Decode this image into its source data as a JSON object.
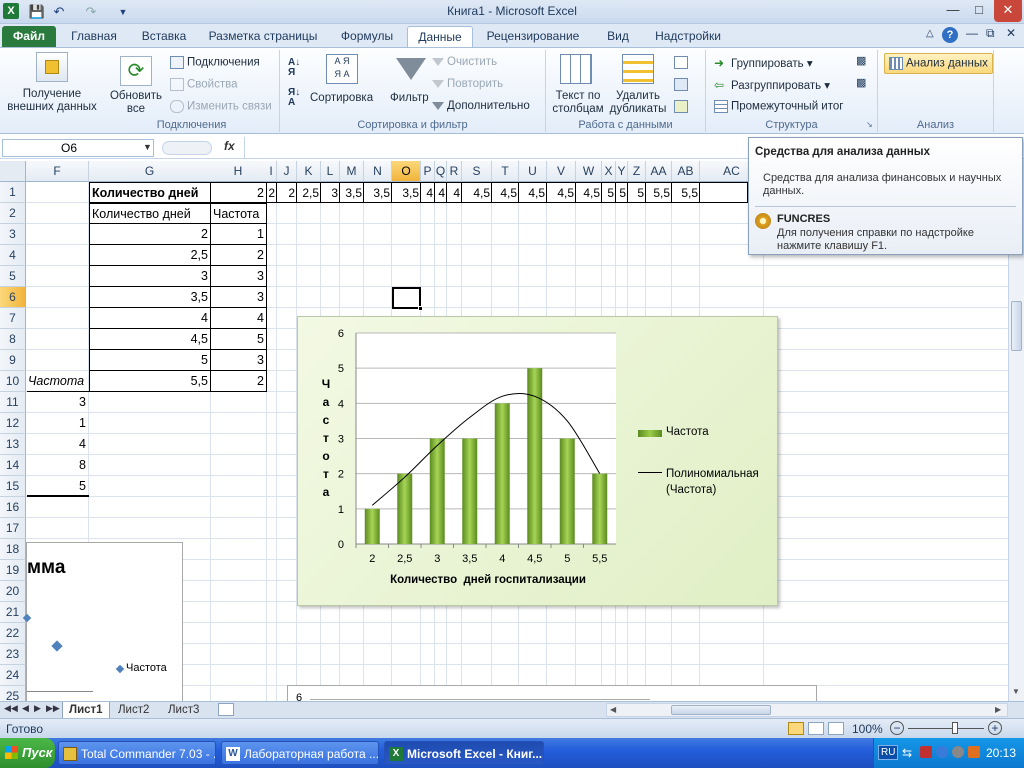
{
  "app": {
    "title": "Книга1  -  Microsoft Excel"
  },
  "tabs": [
    "Файл",
    "Главная",
    "Вставка",
    "Разметка страницы",
    "Формулы",
    "Данные",
    "Рецензирование",
    "Вид",
    "Надстройки"
  ],
  "ribbon": {
    "get_external": "Получение внешних данных",
    "refresh_all": "Обновить все",
    "connections": "Подключения",
    "properties": "Свойства",
    "edit_links": "Изменить связи",
    "group_connections": "Подключения",
    "sort": "Сортировка",
    "filter": "Фильтр",
    "clear": "Очистить",
    "reapply": "Повторить",
    "advanced": "Дополнительно",
    "group_sort": "Сортировка и фильтр",
    "text_to_columns": "Текст по столбцам",
    "remove_duplicates": "Удалить дубликаты",
    "group_data_tools": "Работа с данными",
    "group_btn": "Группировать",
    "ungroup_btn": "Разгруппировать",
    "subtotal": "Промежуточный итог",
    "group_outline": "Структура",
    "data_analysis": "Анализ данных",
    "group_analysis": "Анализ"
  },
  "formula_bar": {
    "name_box": "O6",
    "fx": "fx"
  },
  "grid": {
    "columns": [
      "F",
      "G",
      "H",
      "I",
      "J",
      "K",
      "L",
      "M",
      "N",
      "O",
      "P",
      "Q",
      "R",
      "S",
      "T",
      "U",
      "V",
      "W",
      "X",
      "Y",
      "Z",
      "AA",
      "AB",
      "AC"
    ],
    "rows": [
      "1",
      "2",
      "3",
      "4",
      "5",
      "6",
      "7",
      "8",
      "9",
      "10",
      "11",
      "12",
      "13",
      "14",
      "15",
      "16",
      "17",
      "18",
      "19",
      "20",
      "21",
      "22",
      "23",
      "24",
      "25"
    ],
    "g1": "Количество дней",
    "h1": "2",
    "row1_values": [
      "2",
      "2",
      "2,5",
      "3",
      "3,5",
      "3,5",
      "3,5",
      "4",
      "4",
      "4",
      "4,5",
      "4,5",
      "4,5",
      "4,5",
      "4,5",
      "5",
      "5",
      "5",
      "5,5",
      "5,5"
    ],
    "g2": "Количество дней",
    "h2": "Частота",
    "table_days": [
      "2",
      "2,5",
      "3",
      "3,5",
      "4",
      "4,5",
      "5",
      "5,5"
    ],
    "table_freq": [
      "1",
      "2",
      "3",
      "3",
      "4",
      "5",
      "3",
      "2"
    ],
    "f10": "Частота",
    "f_values": [
      "3",
      "1",
      "4",
      "8",
      "5"
    ]
  },
  "tooltip": {
    "title": "Средства для анализа данных",
    "desc": "Средства для анализа финансовых и научных данных.",
    "addin": "FUNCRES",
    "help": "Для получения справки по надстройке нажмите клавишу F1."
  },
  "chart_data": {
    "type": "bar",
    "categories": [
      "2",
      "2,5",
      "3",
      "3,5",
      "4",
      "4,5",
      "5",
      "5,5"
    ],
    "series": [
      {
        "name": "Частота",
        "values": [
          1,
          2,
          3,
          3,
          4,
          5,
          3,
          2
        ]
      }
    ],
    "trendline": {
      "name": "Полиномиальная (Частота)",
      "values": [
        1.1,
        1.9,
        2.8,
        3.6,
        4.2,
        4.2,
        3.5,
        2
      ]
    },
    "xlabel": "Количество  дней госпитализации",
    "ylabel": "Частота",
    "y_ticks": [
      "0",
      "1",
      "2",
      "3",
      "4",
      "5",
      "6"
    ],
    "ylim": [
      0,
      6
    ],
    "legend_position": "right",
    "colors": {
      "bar": "#8ab83a",
      "bar_dark": "#5a8a1e",
      "line": "#000000"
    }
  },
  "chart2": {
    "title_fragment": "мма",
    "legend": "Частота"
  },
  "chart3": {
    "tick": "6"
  },
  "sheets": [
    "Лист1",
    "Лист2",
    "Лист3"
  ],
  "status": {
    "ready": "Готово",
    "zoom": "100%"
  },
  "taskbar": {
    "start": "Пуск",
    "tasks": [
      "Total Commander 7.03 - ...",
      "Лабораторная работа ...",
      "Microsoft Excel - Книг..."
    ],
    "lang": "RU",
    "time": "20:13"
  }
}
